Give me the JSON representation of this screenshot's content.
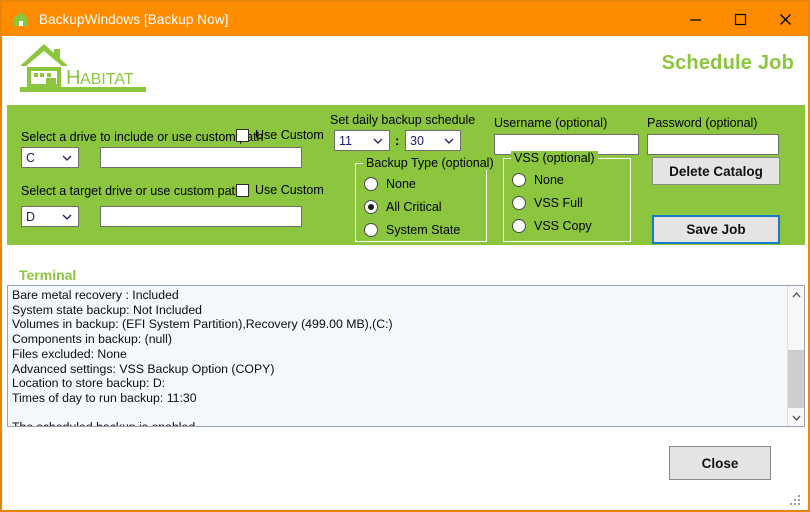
{
  "window": {
    "title": "BackupWindows [Backup Now]",
    "icon": "house-icon",
    "minimize_label": "–",
    "maximize_label": "□",
    "close_label": "✕",
    "titlebar_color": "#ff8c00",
    "border_color": "#e8850a"
  },
  "branding": {
    "logo_text": "HABITAT",
    "logo_color": "#8cc63e",
    "page_title": "Schedule Job"
  },
  "form": {
    "accent_color": "#8cc63e",
    "source": {
      "label": "Select a drive to include or use custom path",
      "drive_value": "C",
      "custom_checkbox_label": "Use Custom",
      "custom_checked": false,
      "custom_path_value": "",
      "custom_path_placeholder": ""
    },
    "target": {
      "label": "Select a target drive or use custom path",
      "drive_value": "D",
      "custom_checkbox_label": "Use Custom",
      "custom_checked": false,
      "custom_path_value": "",
      "custom_path_placeholder": ""
    },
    "schedule": {
      "label": "Set daily backup schedule",
      "hour_value": "11",
      "separator": ":",
      "minute_value": "30"
    },
    "backup_type": {
      "title": "Backup Type (optional)",
      "options": [
        {
          "label": "None",
          "checked": false
        },
        {
          "label": "All Critical",
          "checked": true
        },
        {
          "label": "System State",
          "checked": false
        }
      ]
    },
    "credentials": {
      "username_label": "Username (optional)",
      "username_value": "",
      "password_label": "Password (optional)",
      "password_value": ""
    },
    "vss": {
      "title": "VSS (optional)",
      "options": [
        {
          "label": "None",
          "checked": false
        },
        {
          "label": "VSS Full",
          "checked": false
        },
        {
          "label": "VSS Copy",
          "checked": false
        }
      ]
    },
    "actions": {
      "delete_catalog_label": "Delete Catalog",
      "save_job_label": "Save Job",
      "save_job_focused": true,
      "focus_color": "#1979c9"
    }
  },
  "terminal": {
    "label": "Terminal",
    "label_color": "#8cc63e",
    "background": "#f4f7fb",
    "output": "Bare metal recovery : Included\nSystem state backup: Not Included\nVolumes in backup: (EFI System Partition),Recovery (499.00 MB),(C:)\nComponents in backup: (null)\nFiles excluded: None\nAdvanced settings: VSS Backup Option (COPY)\nLocation to store backup: D:\nTimes of day to run backup: 11:30\n\nThe scheduled backup is enabled.\nNow saving job to database",
    "scrollbar": {
      "up_arrow": "∧",
      "down_arrow": "∨"
    }
  },
  "footer": {
    "close_label": "Close"
  }
}
